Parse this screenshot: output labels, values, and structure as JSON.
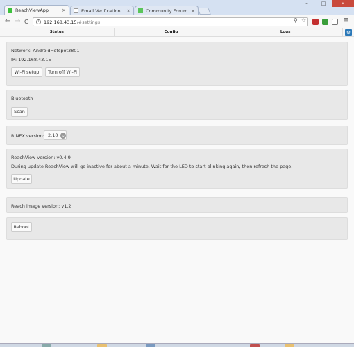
{
  "browser": {
    "tabs": [
      {
        "title": "ReachViewApp",
        "active": true,
        "color": "#3cc13c"
      },
      {
        "title": "Email Verification",
        "active": false,
        "color": "#eeeeee"
      },
      {
        "title": "Community Forum",
        "active": false,
        "color": "#5ac55a"
      }
    ],
    "close_glyph": "×",
    "url_host": "192.168.43.15",
    "url_path": "/#settings",
    "nav": {
      "back": "←",
      "forward": "→",
      "reload": "C"
    },
    "omnibox_icons": {
      "search": "⚲",
      "star": "☆"
    },
    "window_controls": {
      "minimize": "–",
      "maximize": "□",
      "close": "×"
    }
  },
  "app": {
    "nav": [
      "Status",
      "Config",
      "Logs"
    ],
    "settings_glyph": "⚙",
    "network": {
      "name_line": "Network: AndroidHotspot3801",
      "ip_line": "IP: 192.168.43.15",
      "wifi_setup_label": "Wi-Fi setup",
      "wifi_off_label": "Turn off Wi-Fi"
    },
    "bluetooth": {
      "title": "Bluetooth",
      "scan_label": "Scan"
    },
    "rinex": {
      "label": "RINEX version:",
      "selected": "2.10",
      "chevron": "⌄"
    },
    "reachview": {
      "version_line": "ReachView version: v0.4.9",
      "note": "During update ReachView will go inactive for about a minute. Wait for the LED to start blinking again, then refresh the page.",
      "update_label": "Update"
    },
    "image": {
      "version_line": "Reach image version: v1.2"
    },
    "reboot_label": "Reboot"
  },
  "colors": {
    "accent": "#2a78b8",
    "panel_bg": "#e8e8e8",
    "tabstrip": "#d5e1f2"
  }
}
